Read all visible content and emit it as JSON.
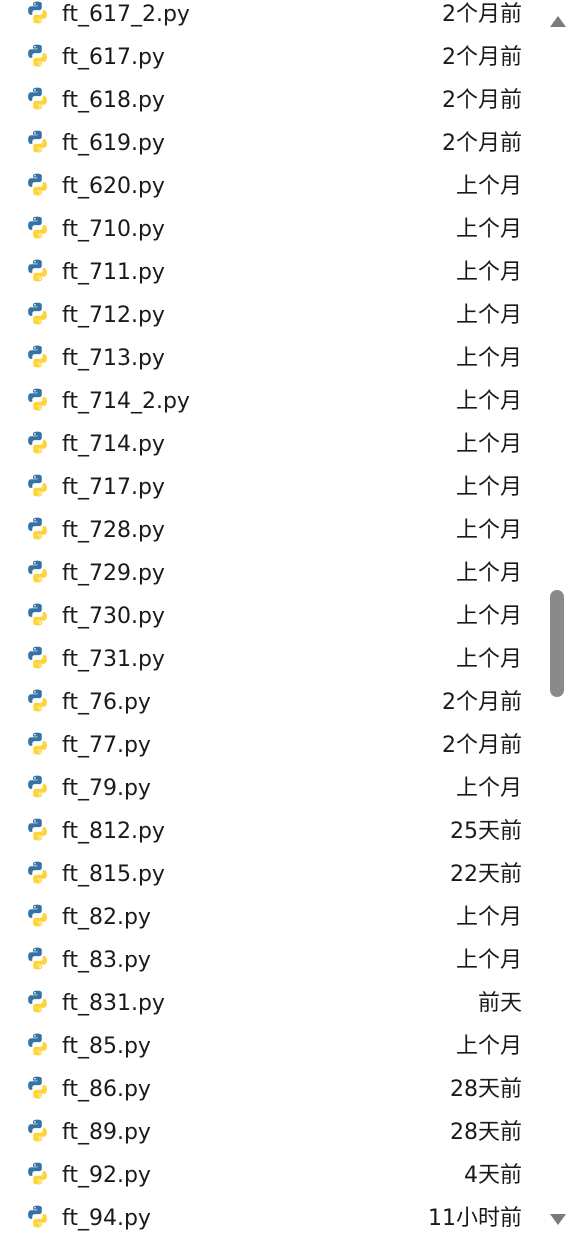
{
  "files": [
    {
      "name": "ft_617_2.py",
      "time": "2个月前"
    },
    {
      "name": "ft_617.py",
      "time": "2个月前"
    },
    {
      "name": "ft_618.py",
      "time": "2个月前"
    },
    {
      "name": "ft_619.py",
      "time": "2个月前"
    },
    {
      "name": "ft_620.py",
      "time": "上个月"
    },
    {
      "name": "ft_710.py",
      "time": "上个月"
    },
    {
      "name": "ft_711.py",
      "time": "上个月"
    },
    {
      "name": "ft_712.py",
      "time": "上个月"
    },
    {
      "name": "ft_713.py",
      "time": "上个月"
    },
    {
      "name": "ft_714_2.py",
      "time": "上个月"
    },
    {
      "name": "ft_714.py",
      "time": "上个月"
    },
    {
      "name": "ft_717.py",
      "time": "上个月"
    },
    {
      "name": "ft_728.py",
      "time": "上个月"
    },
    {
      "name": "ft_729.py",
      "time": "上个月"
    },
    {
      "name": "ft_730.py",
      "time": "上个月"
    },
    {
      "name": "ft_731.py",
      "time": "上个月"
    },
    {
      "name": "ft_76.py",
      "time": "2个月前"
    },
    {
      "name": "ft_77.py",
      "time": "2个月前"
    },
    {
      "name": "ft_79.py",
      "time": "上个月"
    },
    {
      "name": "ft_812.py",
      "time": "25天前"
    },
    {
      "name": "ft_815.py",
      "time": "22天前"
    },
    {
      "name": "ft_82.py",
      "time": "上个月"
    },
    {
      "name": "ft_83.py",
      "time": "上个月"
    },
    {
      "name": "ft_831.py",
      "time": "前天"
    },
    {
      "name": "ft_85.py",
      "time": "上个月"
    },
    {
      "name": "ft_86.py",
      "time": "28天前"
    },
    {
      "name": "ft_89.py",
      "time": "28天前"
    },
    {
      "name": "ft_92.py",
      "time": "4天前"
    },
    {
      "name": "ft_94.py",
      "time": "11小时前"
    }
  ],
  "icons": {
    "file": "python-file-icon"
  },
  "colors": {
    "python_blue": "#3572A5",
    "python_yellow": "#FFD43B",
    "text": "#1a1a1a",
    "scrollbar": "#8a8a8a"
  }
}
